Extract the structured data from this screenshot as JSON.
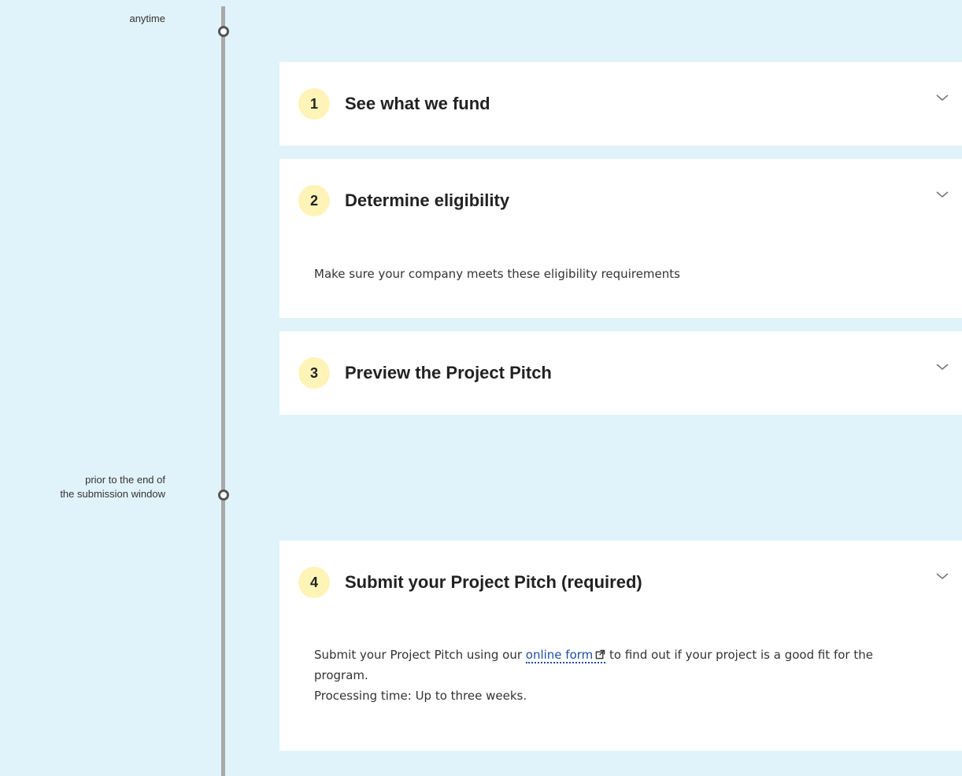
{
  "timeline": {
    "nodes": [
      {
        "label_lines": [
          "anytime"
        ]
      },
      {
        "label_lines": [
          "prior to the end of",
          "the submission window"
        ]
      }
    ]
  },
  "steps": [
    {
      "number": "1",
      "title": "See what we fund"
    },
    {
      "number": "2",
      "title": "Determine eligibility",
      "body": "Make sure your company meets these eligibility requirements"
    },
    {
      "number": "3",
      "title": "Preview the Project Pitch"
    },
    {
      "number": "4",
      "title": "Submit your Project Pitch (required)",
      "body_prefix": "Submit your Project Pitch using our ",
      "link_text": "online form",
      "body_suffix": " to find out if your project is a good fit for the program.",
      "processing": "Processing time: Up to three weeks."
    }
  ],
  "icons": {
    "expand": "chevron-down-icon",
    "external": "external-link-icon"
  },
  "colors": {
    "background": "#e1f3fa",
    "badge": "#fff4b8",
    "link": "#1f4e9e",
    "timeline": "#a9a9a9"
  }
}
